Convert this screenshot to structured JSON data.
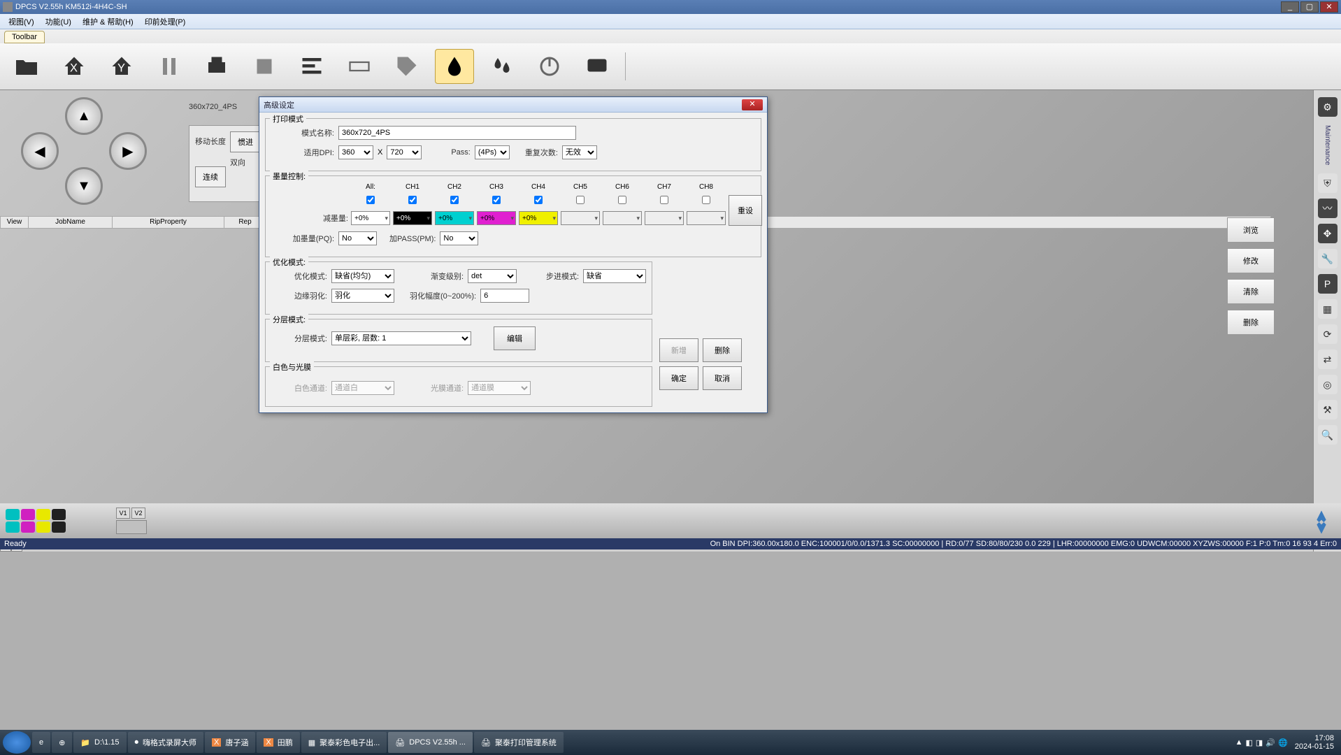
{
  "app": {
    "title": "DPCS    V2.55h   KM512i-4H4C-SH"
  },
  "menu": {
    "view": "视图(V)",
    "func": "功能(U)",
    "maint": "维护 & 帮助(H)",
    "prepress": "印前处理(P)"
  },
  "toolbar_tab": "Toolbar",
  "canvas_label": "360x720_4PS",
  "panel": {
    "move_len": "移动长度",
    "manual": "惯进",
    "bidir": "双向",
    "connect": "连续"
  },
  "list_hdr": {
    "view": "View",
    "job": "JobName",
    "rip": "RipProperty",
    "rep": "Rep"
  },
  "right_btns": {
    "preview": "浏览",
    "modify": "修改",
    "clear": "清除",
    "delete": "删除"
  },
  "maint_label": "Maintenance",
  "dialog": {
    "title": "高级设定",
    "sec_print": "打印模式",
    "mode_name_lbl": "模式名称:",
    "mode_name": "360x720_4PS",
    "dpi_lbl": "适用DPI:",
    "dpi_x": "360",
    "x": "X",
    "dpi_y": "720",
    "pass_lbl": "Pass:",
    "pass": "(4Ps)",
    "repeat_lbl": "重复次数:",
    "repeat": "无效",
    "sec_ink": "墨量控制:",
    "ch_all": "All:",
    "ch1": "CH1",
    "ch2": "CH2",
    "ch3": "CH3",
    "ch4": "CH4",
    "ch5": "CH5",
    "ch6": "CH6",
    "ch7": "CH7",
    "ch8": "CH8",
    "reduce_lbl": "减墨量:",
    "reduce": [
      "+0%",
      "+0%",
      "+0%",
      "+0%",
      "+0%"
    ],
    "reset_btn": "重设",
    "addpq_lbl": "加墨量(PQ):",
    "addpq": "No",
    "addpass_lbl": "加PASS(PM):",
    "addpass": "No",
    "sec_opt": "优化模式:",
    "opt_mode_lbl": "优化模式:",
    "opt_mode": "缺省(均匀)",
    "grad_lbl": "渐变级别:",
    "grad": "det",
    "step_lbl": "步进模式:",
    "step": "缺省",
    "feather_lbl": "边缘羽化:",
    "feather": "羽化",
    "feather_amt_lbl": "羽化幅度(0~200%):",
    "feather_amt": "6",
    "sec_layer": "分层模式:",
    "layer_lbl": "分层模式:",
    "layer": "单层彩, 层数: 1",
    "edit_btn": "编辑",
    "sec_white": "白色与光膜",
    "white_lbl": "白色通道:",
    "white": "通道白",
    "gloss_lbl": "光膜通道:",
    "gloss": "通道膜",
    "btn_add": "新增",
    "btn_del": "删除",
    "btn_ok": "确定",
    "btn_cancel": "取消"
  },
  "ink_colors": [
    "#00c0c0",
    "#d020c0",
    "#e8e800",
    "#000000",
    "#00c0c0",
    "#d020c0",
    "#e8e800",
    "#000000"
  ],
  "v_toggle": {
    "v1": "V1",
    "v2": "V2"
  },
  "status": {
    "left": "Ready",
    "right": "On BIN DPI:360.00x180.0 ENC:100001/0/0.0/1371.3 SC:00000000 | RD:0/77 SD:80/80/230 0.0 229 | LHR:00000000 EMG:0 UDWCM:00000 XYZWS:00000 F:1 P:0 Tm:0 16 93 4 Err:0"
  },
  "taskbar": {
    "items": [
      {
        "label": "D:\\1.15"
      },
      {
        "label": "嗨格式录屏大师"
      },
      {
        "label": "唐子涵"
      },
      {
        "label": "田鹏"
      },
      {
        "label": "聚泰彩色电子出..."
      },
      {
        "label": "DPCS    V2.55h ..."
      },
      {
        "label": "聚泰打印管理系统"
      }
    ],
    "time": "17:08",
    "date": "2024-01-15"
  }
}
